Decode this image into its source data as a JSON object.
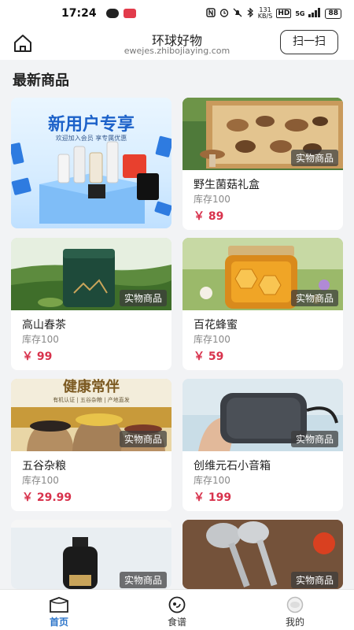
{
  "status_bar": {
    "time": "17:24",
    "net_speed_value": "131",
    "net_speed_unit": "KB/S",
    "hd": "HD",
    "signal": "5G",
    "battery": "88"
  },
  "header": {
    "title": "环球好物",
    "subtitle": "ewejes.zhibojiaying.com",
    "scan_label": "扫一扫"
  },
  "section": {
    "title": "最新商品"
  },
  "promo": {
    "title": "新用户专享",
    "subtitle": "欢迎加入会员  享专属优惠"
  },
  "products": [
    {
      "name": "野生菌菇礼盒",
      "stock": "库存100",
      "price": "￥ 89",
      "tag": "实物商品"
    },
    {
      "name": "高山春茶",
      "stock": "库存100",
      "price": "￥ 99",
      "tag": "实物商品"
    },
    {
      "name": "百花蜂蜜",
      "stock": "库存100",
      "price": "￥ 59",
      "tag": "实物商品"
    },
    {
      "name": "五谷杂粮",
      "stock": "库存100",
      "price": "￥ 29.99",
      "tag": "实物商品",
      "banner": "健康常伴",
      "banner_sub": "有机认证 | 五谷杂粮 | 产地直发"
    },
    {
      "name": "创维元石小音箱",
      "stock": "库存100",
      "price": "￥ 199",
      "tag": "实物商品"
    },
    {
      "tag": "实物商品"
    },
    {
      "tag": "实物商品"
    }
  ],
  "tabbar": {
    "items": [
      {
        "label": "首页",
        "active": true
      },
      {
        "label": "食谱",
        "active": false
      },
      {
        "label": "我的",
        "active": false
      }
    ]
  },
  "colors": {
    "accent": "#2b74c9",
    "price": "#d8324c",
    "background": "#f2f3f5"
  }
}
